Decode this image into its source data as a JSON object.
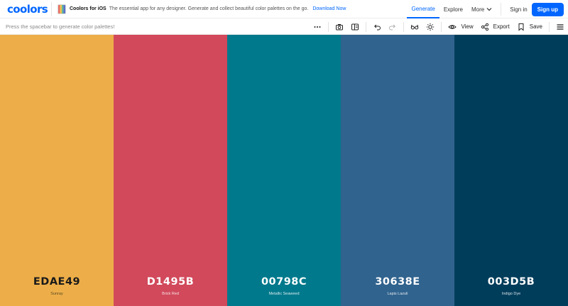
{
  "brand": {
    "logo": "coolors"
  },
  "promo": {
    "title": "Coolors for iOS",
    "text": "The essential app for any designer. Generate and collect beautiful color palettes on the go.",
    "link": "Download Now"
  },
  "nav": {
    "generate": "Generate",
    "explore": "Explore",
    "more": "More",
    "signin": "Sign in",
    "signup": "Sign up"
  },
  "toolbar": {
    "hint": "Press the spacebar to generate color palettes!",
    "view": "View",
    "export": "Export",
    "save": "Save"
  },
  "palette": [
    {
      "hex": "EDAE49",
      "name": "Sunray",
      "color": "#EDAE49",
      "tone": "light"
    },
    {
      "hex": "D1495B",
      "name": "Brick Red",
      "color": "#D1495B",
      "tone": "dark"
    },
    {
      "hex": "00798C",
      "name": "Metallic Seaweed",
      "color": "#00798C",
      "tone": "dark"
    },
    {
      "hex": "30638E",
      "name": "Lapis Lazuli",
      "color": "#30638E",
      "tone": "dark"
    },
    {
      "hex": "003D5B",
      "name": "Indigo Dye",
      "color": "#003D5B",
      "tone": "dark"
    }
  ],
  "colors": {
    "accent": "#0066ff"
  }
}
